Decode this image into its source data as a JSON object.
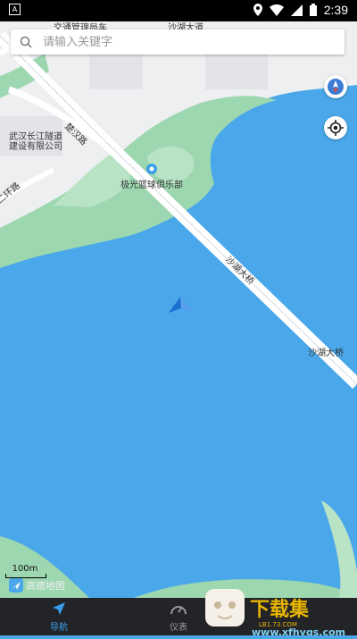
{
  "status": {
    "time": "2:39",
    "notification_letter": "A"
  },
  "search": {
    "placeholder": "请输入关键字"
  },
  "map": {
    "labels": {
      "top_company": "交通管理局车",
      "top_road": "沙湖大道",
      "road_chuhan": "楚汉路",
      "company_line1": "武汉长江隧道",
      "company_line2": "建设有限公司",
      "ring_road": "二环路",
      "poi": "极光篮球俱乐部",
      "bridge_diag": "沙湖大桥",
      "bridge_right": "沙湖大桥"
    },
    "scale": "100m",
    "brand": "高德地图"
  },
  "buttons": {
    "compass": "compass-icon",
    "locate": "locate-icon"
  },
  "nav": {
    "tabs": [
      {
        "label": "导航"
      },
      {
        "label": "仪表"
      }
    ]
  },
  "watermark": {
    "text": "下载集",
    "sub": "LB1.73.COM",
    "site": "www.xfhygs.com"
  }
}
